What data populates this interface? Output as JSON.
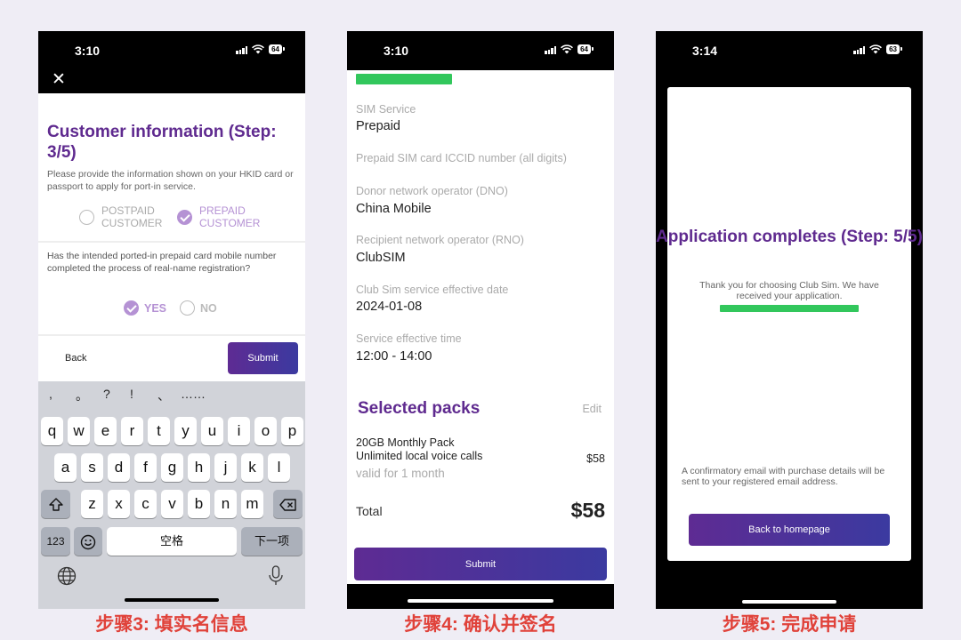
{
  "colors": {
    "brand_purple": "#5f2a8f",
    "button_gradient": [
      "#5e2b93",
      "#3b3aa0"
    ],
    "success_green": "#32c75c",
    "caption_red": "#e0423a",
    "radio_checked": "#b592d4"
  },
  "phone1": {
    "status": {
      "time": "3:10",
      "battery": "64"
    },
    "title": "Customer information (Step: 3/5)",
    "description": "Please provide the information shown on your HKID card or passport to apply for port-in service.",
    "customer_type": {
      "option1": "POSTPAID\nCUSTOMER",
      "option2": "PREPAID\nCUSTOMER",
      "selected": "option2"
    },
    "question": "Has the intended ported-in prepaid card mobile number completed the process of real-name registration?",
    "answers": {
      "yes": "YES",
      "no": "NO",
      "selected": "yes"
    },
    "back_label": "Back",
    "submit_label": "Submit",
    "keyboard": {
      "symbols": [
        ",",
        "。",
        "?",
        "!",
        "、",
        "……"
      ],
      "row1": [
        "q",
        "w",
        "e",
        "r",
        "t",
        "y",
        "u",
        "i",
        "o",
        "p"
      ],
      "row2": [
        "a",
        "s",
        "d",
        "f",
        "g",
        "h",
        "j",
        "k",
        "l"
      ],
      "row3": [
        "z",
        "x",
        "c",
        "v",
        "b",
        "n",
        "m"
      ],
      "numbers_key": "123",
      "space_key": "空格",
      "next_key": "下一项"
    },
    "caption": "步骤3: 填实名信息"
  },
  "phone2": {
    "status": {
      "time": "3:10",
      "battery": "64"
    },
    "fields": [
      {
        "label": "SIM Service",
        "value": "Prepaid"
      },
      {
        "label": "Prepaid SIM card ICCID number (all digits)",
        "value": ""
      },
      {
        "label": "Donor network operator (DNO)",
        "value": "China Mobile"
      },
      {
        "label": "Recipient network operator (RNO)",
        "value": "ClubSIM"
      },
      {
        "label": "Club Sim service effective date",
        "value": "2024-01-08"
      },
      {
        "label": "Service effective time",
        "value": "12:00 - 14:00"
      }
    ],
    "packs_title": "Selected packs",
    "edit_label": "Edit",
    "pack": {
      "name": "20GB Monthly Pack",
      "detail": "Unlimited local voice calls",
      "price": "$58",
      "validity": "valid for  1 month"
    },
    "total_label": "Total",
    "total_value": "$58",
    "submit_label": "Submit",
    "caption": "步骤4: 确认并签名"
  },
  "phone3": {
    "status": {
      "time": "3:14",
      "battery": "63"
    },
    "title": "Application completes (Step: 5/5)",
    "thanks": "Thank you for choosing Club Sim. We have received your application.",
    "note": "A confirmatory email with purchase details will be sent to your registered email address.",
    "home_button": "Back to homepage",
    "caption": "步骤5: 完成申请"
  }
}
